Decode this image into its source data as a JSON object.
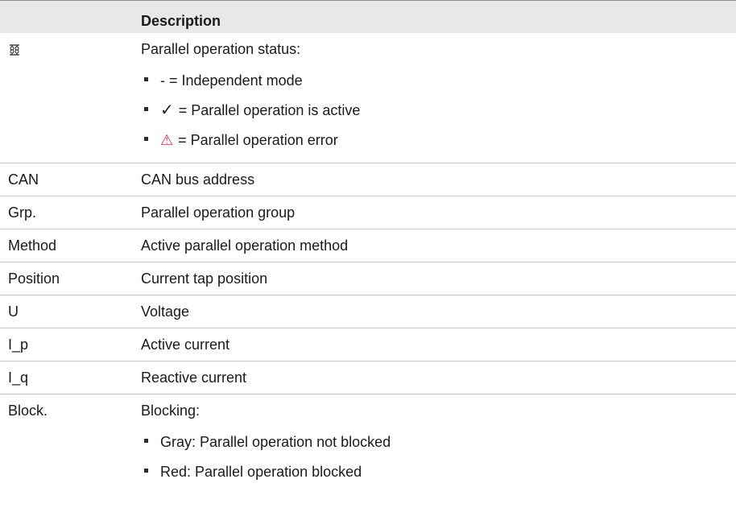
{
  "table": {
    "header": {
      "key": "",
      "description": "Description"
    },
    "parallel_status": {
      "icon": "parallel-operation-icon",
      "title": "Parallel operation status:",
      "items": [
        {
          "icon": "",
          "text": "- = Independent mode"
        },
        {
          "icon": "check-icon",
          "glyph": "✓",
          "text": "= Parallel operation is active"
        },
        {
          "icon": "warning-icon",
          "glyph": "⚠",
          "color": "#d42a3a",
          "text": "= Parallel operation error"
        }
      ]
    },
    "rows": [
      {
        "key": "CAN",
        "description": "CAN bus address"
      },
      {
        "key": "Grp.",
        "description": "Parallel operation group"
      },
      {
        "key": "Method",
        "description": "Active parallel operation method"
      },
      {
        "key": "Position",
        "description": "Current tap position"
      },
      {
        "key": "U",
        "description": "Voltage"
      },
      {
        "key": "I_p",
        "description": "Active current"
      },
      {
        "key": "I_q",
        "description": "Reactive current"
      }
    ],
    "blocking": {
      "key": "Block.",
      "title": "Blocking:",
      "items": [
        {
          "text": "Gray: Parallel operation not blocked"
        },
        {
          "text": "Red: Parallel operation blocked"
        }
      ]
    }
  }
}
